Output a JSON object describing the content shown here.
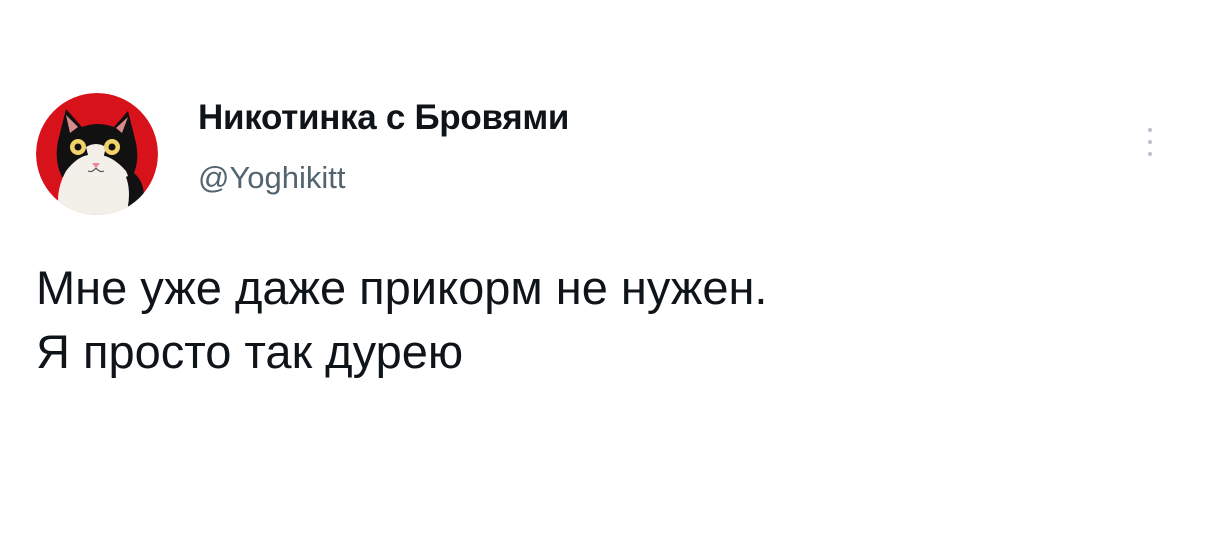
{
  "tweet": {
    "author": {
      "display_name": "Никотинка с Бровями",
      "handle": "@Yoghikitt",
      "avatar_icon": "cat-avatar-icon"
    },
    "more_icon": "more-options-icon",
    "text_lines": [
      "Мне уже даже прикорм не нужен.",
      "Я просто так дурею"
    ]
  },
  "colors": {
    "background": "#ffffff",
    "name": "#0f1419",
    "handle": "#536471",
    "avatar_bg": "#d8121b"
  }
}
